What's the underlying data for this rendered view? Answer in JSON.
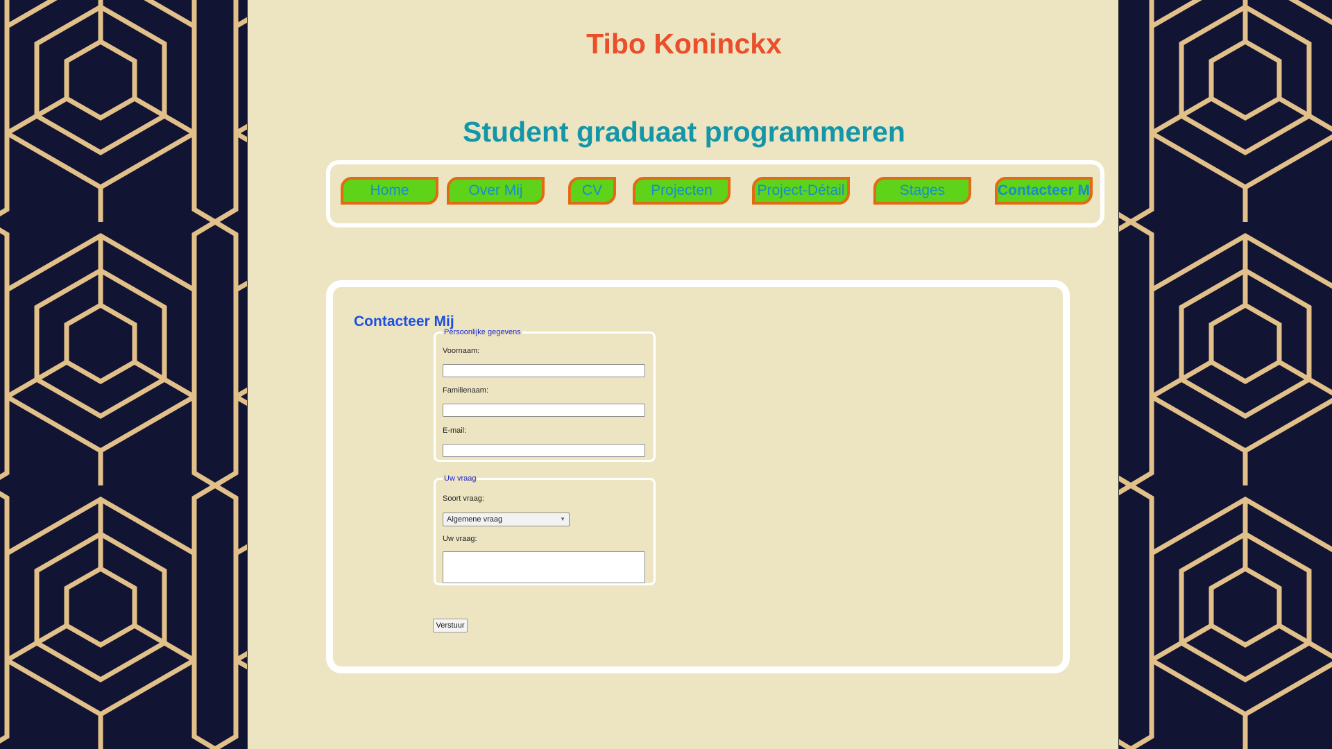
{
  "header": {
    "title": "Tibo Koninckx",
    "subtitle": "Student graduaat programmeren"
  },
  "nav": {
    "items": [
      {
        "label": "Home"
      },
      {
        "label": "Over Mij"
      },
      {
        "label": "CV"
      },
      {
        "label": "Projecten"
      },
      {
        "label": "Project-Détail"
      },
      {
        "label": "Stages"
      },
      {
        "label": "Contacteer Mij"
      }
    ],
    "active": "Contacteer Mij"
  },
  "contact": {
    "heading": "Contacteer Mij",
    "personal": {
      "legend": "Persoonlijke gegevens",
      "first_name_label": "Voornaam:",
      "first_name_value": "",
      "last_name_label": "Familienaam:",
      "last_name_value": "",
      "email_label": "E-mail:",
      "email_value": ""
    },
    "question": {
      "legend": "Uw vraag",
      "type_label": "Soort vraag:",
      "type_value": "Algemene vraag",
      "question_label": "Uw vraag:"
    },
    "submit_label": "Verstuur"
  },
  "colors": {
    "page_bg": "#ede5c2",
    "title": "#ea4e2a",
    "subtitle": "#1396a8",
    "nav_fill": "#5fd21a",
    "nav_border": "#e06b12",
    "nav_text": "#1390c8",
    "heading": "#1b4fe0",
    "pattern_dark": "#121433",
    "pattern_gold": "#e2c08a"
  }
}
